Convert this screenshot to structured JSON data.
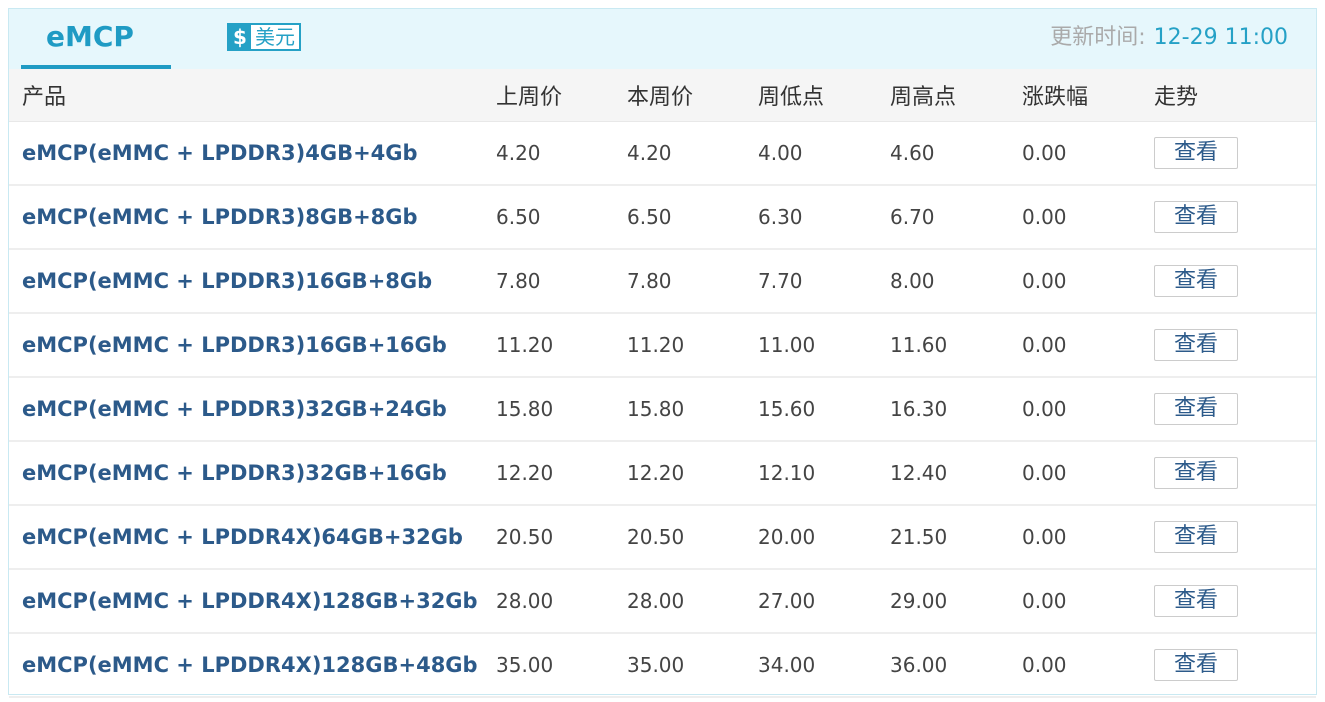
{
  "tab": {
    "label": "eMCP"
  },
  "currency": {
    "symbol": "$",
    "label": "美元"
  },
  "update": {
    "label": "更新时间:",
    "time": "12-29 11:00"
  },
  "table": {
    "headers": [
      "产品",
      "上周价",
      "本周价",
      "周低点",
      "周高点",
      "涨跌幅",
      "走势"
    ],
    "view_label": "查看",
    "rows": [
      {
        "product": "eMCP(eMMC + LPDDR3)4GB+4Gb",
        "last_week": "4.20",
        "this_week": "4.20",
        "week_low": "4.00",
        "week_high": "4.60",
        "change": "0.00"
      },
      {
        "product": "eMCP(eMMC + LPDDR3)8GB+8Gb",
        "last_week": "6.50",
        "this_week": "6.50",
        "week_low": "6.30",
        "week_high": "6.70",
        "change": "0.00"
      },
      {
        "product": "eMCP(eMMC + LPDDR3)16GB+8Gb",
        "last_week": "7.80",
        "this_week": "7.80",
        "week_low": "7.70",
        "week_high": "8.00",
        "change": "0.00"
      },
      {
        "product": "eMCP(eMMC + LPDDR3)16GB+16Gb",
        "last_week": "11.20",
        "this_week": "11.20",
        "week_low": "11.00",
        "week_high": "11.60",
        "change": "0.00"
      },
      {
        "product": "eMCP(eMMC + LPDDR3)32GB+24Gb",
        "last_week": "15.80",
        "this_week": "15.80",
        "week_low": "15.60",
        "week_high": "16.30",
        "change": "0.00"
      },
      {
        "product": "eMCP(eMMC + LPDDR3)32GB+16Gb",
        "last_week": "12.20",
        "this_week": "12.20",
        "week_low": "12.10",
        "week_high": "12.40",
        "change": "0.00"
      },
      {
        "product": "eMCP(eMMC + LPDDR4X)64GB+32Gb",
        "last_week": "20.50",
        "this_week": "20.50",
        "week_low": "20.00",
        "week_high": "21.50",
        "change": "0.00"
      },
      {
        "product": "eMCP(eMMC + LPDDR4X)128GB+32Gb",
        "last_week": "28.00",
        "this_week": "28.00",
        "week_low": "27.00",
        "week_high": "29.00",
        "change": "0.00"
      },
      {
        "product": "eMCP(eMMC + LPDDR4X)128GB+48Gb",
        "last_week": "35.00",
        "this_week": "35.00",
        "week_low": "34.00",
        "week_high": "36.00",
        "change": "0.00"
      }
    ]
  },
  "colors": {
    "accent": "#1f9bc4",
    "product_text": "#2c5a8a",
    "header_bg": "#e6f7fc"
  }
}
